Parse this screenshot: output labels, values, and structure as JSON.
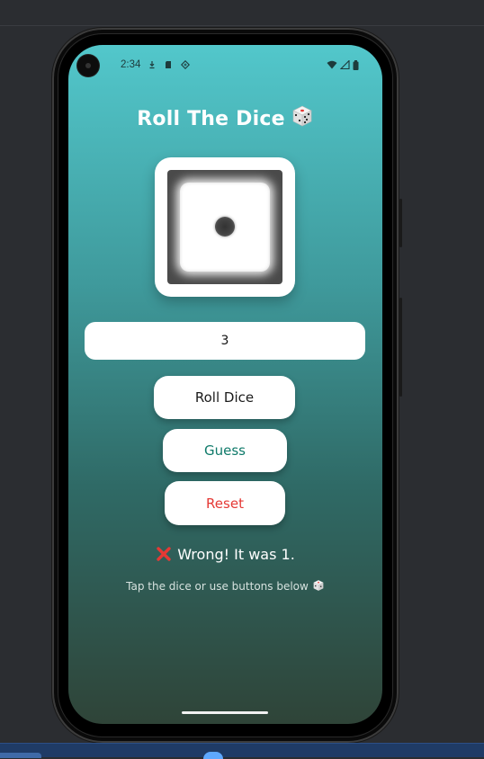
{
  "status_bar": {
    "time": "2:34",
    "left_icons": [
      "download-icon",
      "sd-card-icon",
      "sync-icon"
    ],
    "right_icons": [
      "wifi-icon",
      "signal-icon",
      "battery-icon"
    ]
  },
  "app": {
    "title": "Roll The Dice",
    "title_icon": "dice-icon",
    "dice_face_value": 1,
    "guess_input_value": "3",
    "buttons": {
      "roll_label": "Roll Dice",
      "guess_label": "Guess",
      "reset_label": "Reset"
    },
    "result_icon": "red-x-icon",
    "result_text": "Wrong! It was 1.",
    "hint_text": "Tap the dice or use buttons below",
    "hint_icon": "dice-icon"
  },
  "colors": {
    "gradient_top": "#52c7cb",
    "gradient_bottom": "#2f4438",
    "guess_button_text": "#0f7a6a",
    "reset_button_text": "#e53935",
    "result_x": "#e53935"
  }
}
